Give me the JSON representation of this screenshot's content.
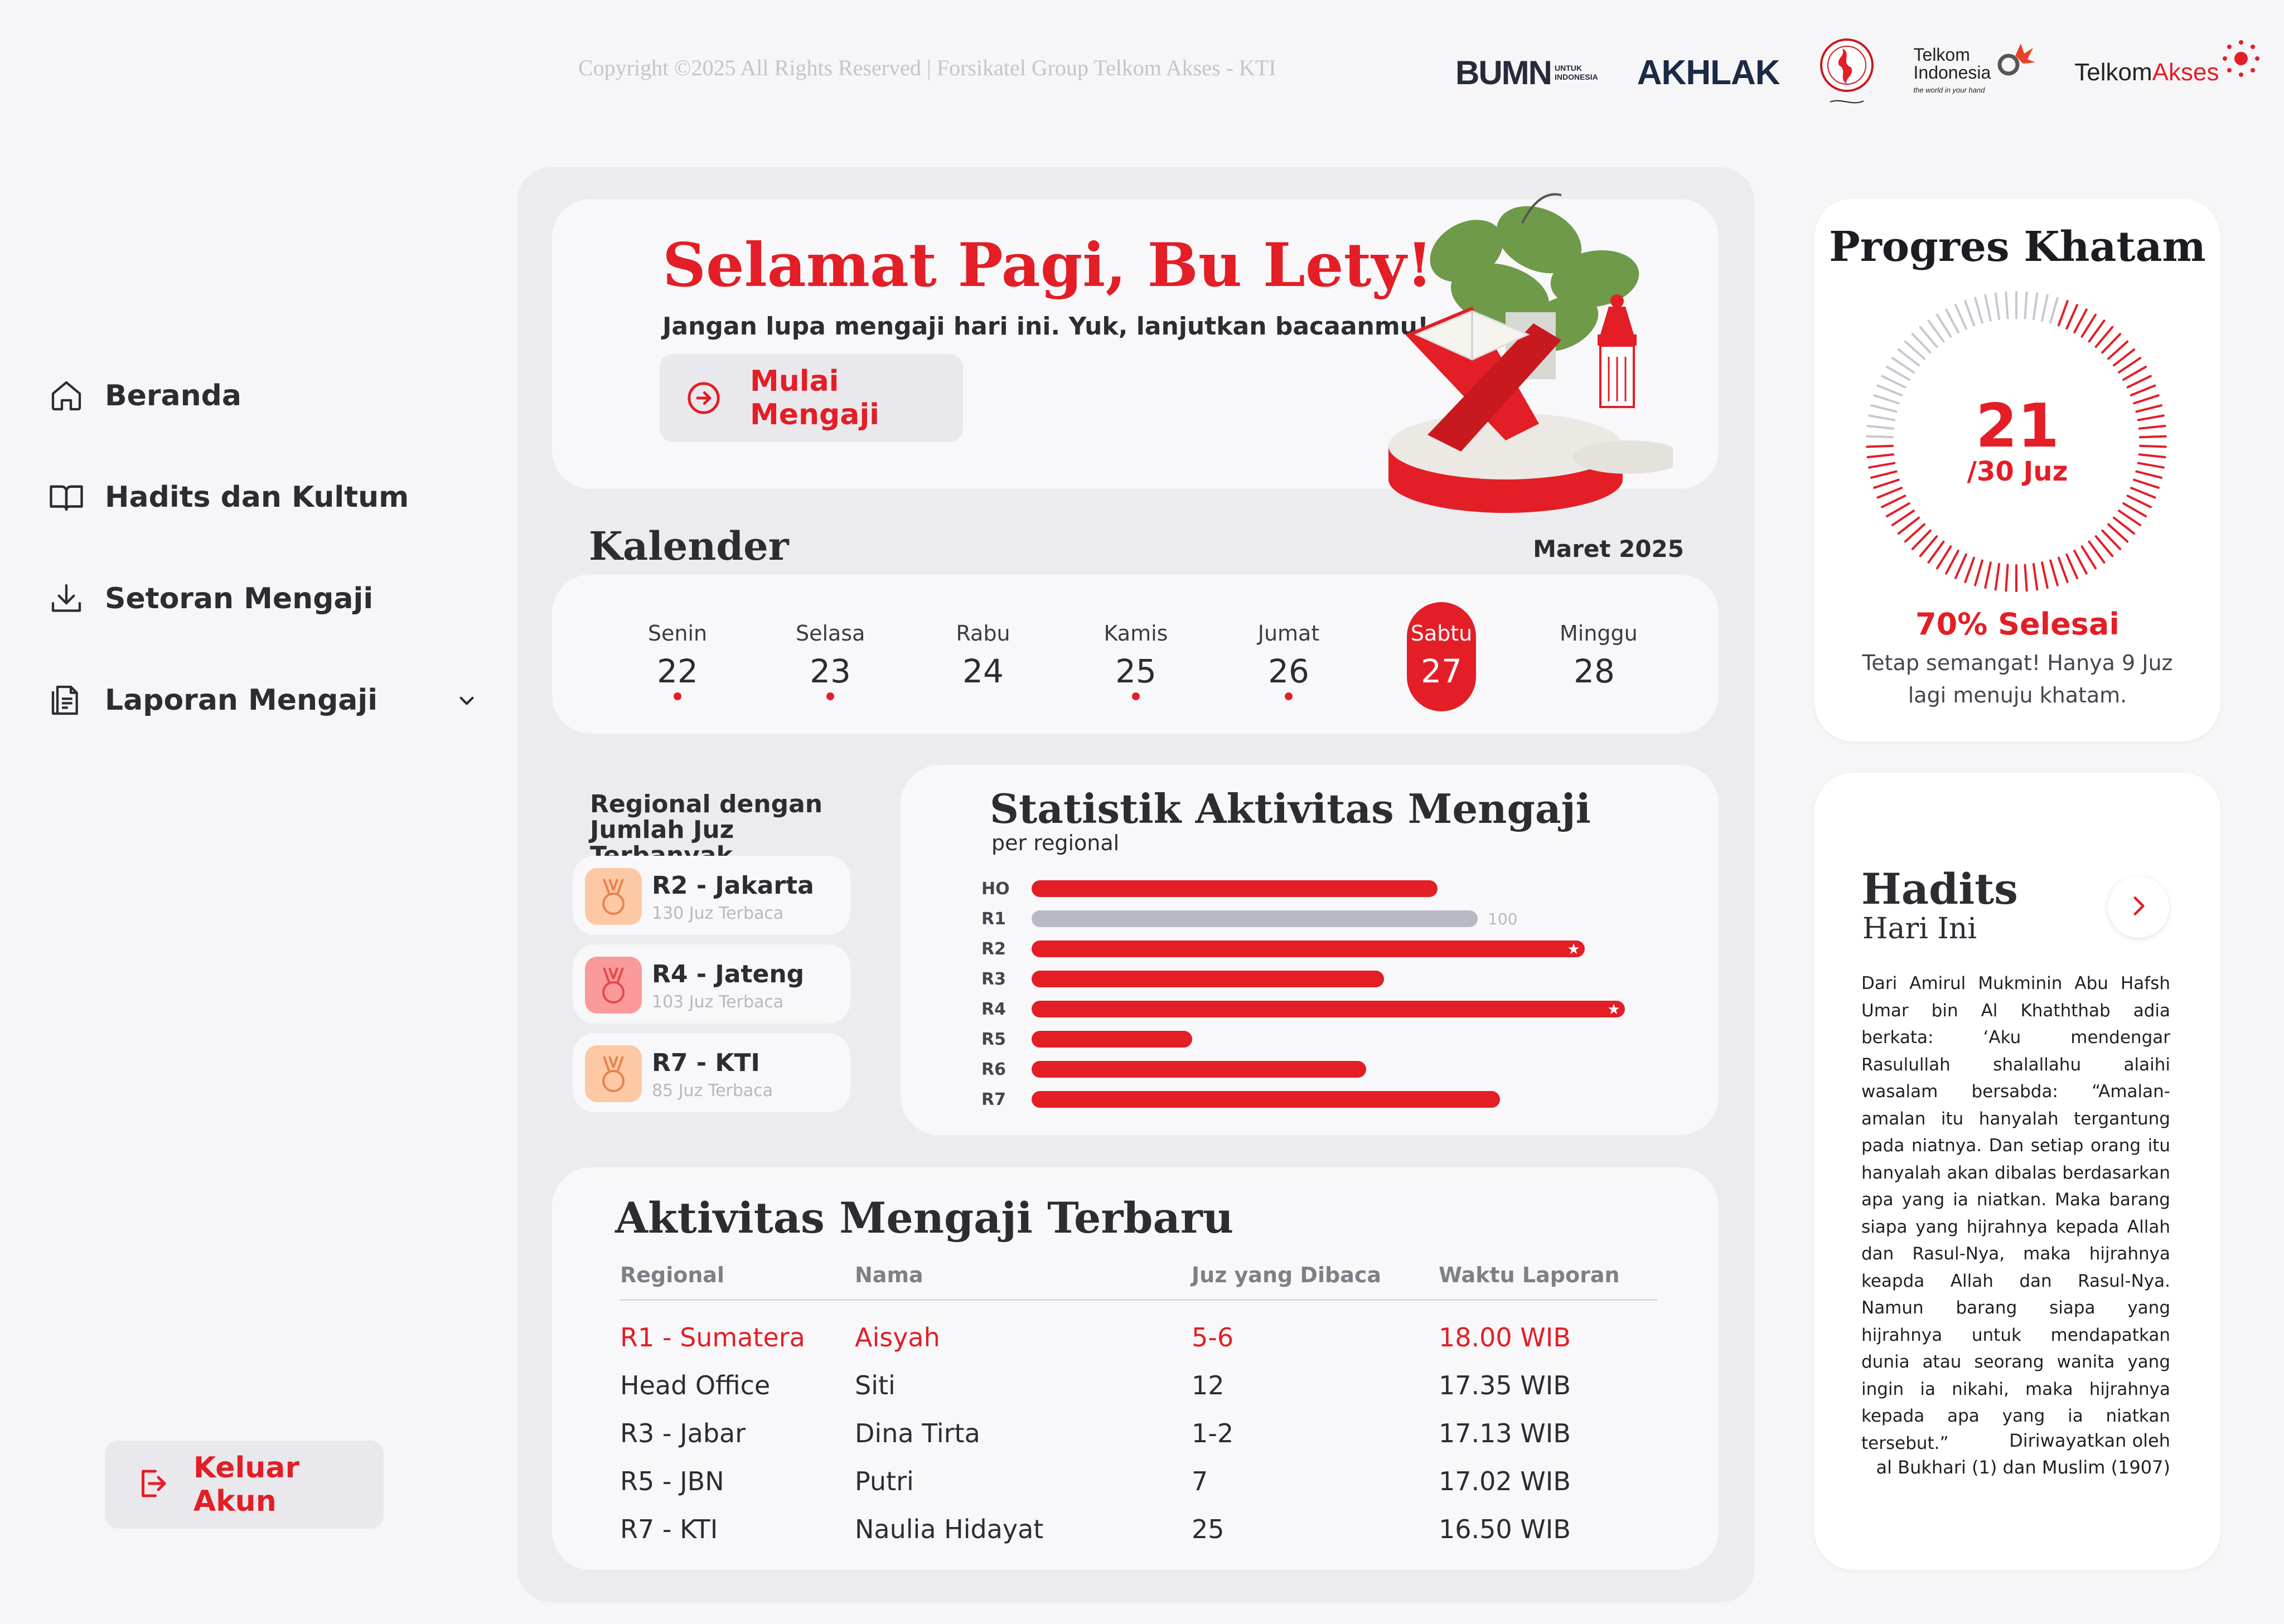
{
  "header": {
    "copyright": "Copyright ©2025 All Rights Reserved | Forsikatel Group Telkom Akses - KTI",
    "logos": {
      "bumn": "BUMN",
      "bumn_tag": "UNTUK INDONESIA",
      "akhlak": "AKHLAK",
      "telkom_line1": "Telkom",
      "telkom_line2": "Indonesia",
      "telkom_tagline": "the world in your hand",
      "telkomakses_a": "Telkom",
      "telkomakses_b": "Akses"
    }
  },
  "sidebar": {
    "items": [
      {
        "label": "Beranda",
        "icon": "home-icon"
      },
      {
        "label": "Hadits dan Kultum",
        "icon": "book-icon"
      },
      {
        "label": "Setoran Mengaji",
        "icon": "download-icon"
      },
      {
        "label": "Laporan Mengaji",
        "icon": "document-icon"
      }
    ],
    "logout_label": "Keluar Akun"
  },
  "greeting": {
    "title": "Selamat Pagi, Bu Lety!",
    "subtitle": "Jangan lupa mengaji hari ini. Yuk, lanjutkan bacaanmu!",
    "button_label": "Mulai Mengaji"
  },
  "calendar": {
    "title": "Kalender",
    "month": "Maret 2025",
    "days": [
      {
        "name": "Senin",
        "date": "22",
        "dot": true,
        "active": false
      },
      {
        "name": "Selasa",
        "date": "23",
        "dot": true,
        "active": false
      },
      {
        "name": "Rabu",
        "date": "24",
        "dot": false,
        "active": false
      },
      {
        "name": "Kamis",
        "date": "25",
        "dot": true,
        "active": false
      },
      {
        "name": "Jumat",
        "date": "26",
        "dot": true,
        "active": false
      },
      {
        "name": "Sabtu",
        "date": "27",
        "dot": false,
        "active": true
      },
      {
        "name": "Minggu",
        "date": "28",
        "dot": false,
        "active": false
      }
    ]
  },
  "regional_top": {
    "title_line1": "Regional dengan",
    "title_line2": "Jumlah Juz Terbanyak",
    "items": [
      {
        "name": "R2 - Jakarta",
        "sub": "130 Juz Terbaca",
        "color": "#fcc9a4"
      },
      {
        "name": "R4 - Jateng",
        "sub": "103 Juz Terbaca",
        "color": "#fb9a9a"
      },
      {
        "name": "R7 - KTI",
        "sub": "85 Juz Terbaca",
        "color": "#fcc9a4"
      }
    ]
  },
  "stats": {
    "title": "Statistik Aktivitas Mengaji",
    "subtitle": "per regional",
    "chart_data": {
      "type": "bar",
      "orientation": "horizontal",
      "categories": [
        "HO",
        "R1",
        "R2",
        "R3",
        "R4",
        "R5",
        "R6",
        "R7"
      ],
      "values": [
        91,
        100,
        124,
        79,
        133,
        36,
        75,
        105
      ],
      "highlight_label": "100",
      "highlighted_category": "R1",
      "starred_categories": [
        "R2",
        "R4"
      ],
      "bar_color": "#e31e26",
      "highlight_color": "#b7b9c4"
    }
  },
  "activity": {
    "title": "Aktivitas Mengaji Terbaru",
    "headers": [
      "Regional",
      "Nama",
      "Juz yang Dibaca",
      "Waktu Laporan"
    ],
    "rows": [
      [
        "R1 - Sumatera",
        "Aisyah",
        "5-6",
        "18.00 WIB"
      ],
      [
        "Head Office",
        "Siti",
        "12",
        "17.35 WIB"
      ],
      [
        "R3 - Jabar",
        "Dina Tirta",
        "1-2",
        "17.13 WIB"
      ],
      [
        "R5 - JBN",
        "Putri",
        "7",
        "17.02 WIB"
      ],
      [
        "R7 - KTI",
        "Naulia Hidayat",
        "25",
        "16.50 WIB"
      ]
    ],
    "highlight_color": "#e31e26"
  },
  "progress": {
    "title": "Progres Khatam",
    "current": "21",
    "unit": "/30 Juz",
    "percent_label": "70% Selesai",
    "fraction": 0.7,
    "message": "Tetap semangat! Hanya 9 Juz lagi menuju khatam."
  },
  "hadits": {
    "title": "Hadits",
    "subtitle": "Hari Ini",
    "text": "Dari Amirul Mukminin Abu Hafsh Umar bin Al Khaththab adia berkata: ‘Aku mendengar Rasulullah shalallahu alaihi wasalam bersabda: “Amalan-amalan itu hanyalah tergantung pada niatnya. Dan setiap orang itu hanyalah akan dibalas berdasarkan apa yang ia niatkan. Maka barang siapa yang hijrahnya kepada Allah dan Rasul-Nya, maka hijrahnya keapda Allah dan Rasul-Nya. Namun barang siapa yang hijrahnya untuk mendapatkan dunia atau seorang wanita yang ingin ia nikahi, maka hijrahnya kepada apa yang ia niatkan tersebut.”",
    "source_line1": "Diriwayatkan oleh",
    "source_line2": "al Bukhari (1) dan Muslim (1907)"
  }
}
